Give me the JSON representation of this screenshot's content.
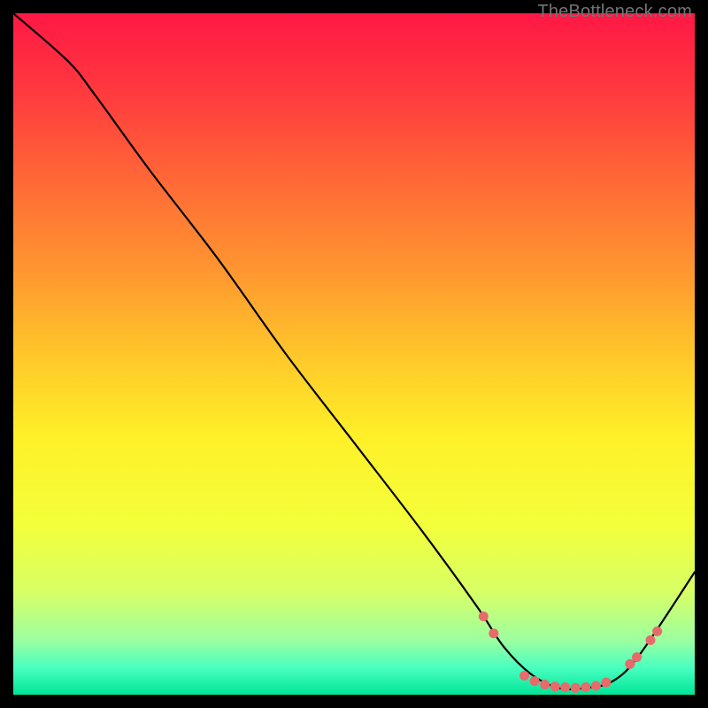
{
  "watermark": "TheBottleneck.com",
  "chart_data": {
    "type": "line",
    "title": "",
    "xlabel": "",
    "ylabel": "",
    "xlim": [
      0,
      100
    ],
    "ylim": [
      0,
      100
    ],
    "grid": false,
    "legend": false,
    "background_gradient_stops": [
      {
        "offset": 0.0,
        "color": "#ff1845"
      },
      {
        "offset": 0.12,
        "color": "#ff3b3e"
      },
      {
        "offset": 0.25,
        "color": "#ff6a36"
      },
      {
        "offset": 0.38,
        "color": "#ff9730"
      },
      {
        "offset": 0.5,
        "color": "#ffc62a"
      },
      {
        "offset": 0.62,
        "color": "#fff028"
      },
      {
        "offset": 0.75,
        "color": "#f3ff3a"
      },
      {
        "offset": 0.85,
        "color": "#d7ff66"
      },
      {
        "offset": 0.92,
        "color": "#9cffa0"
      },
      {
        "offset": 0.96,
        "color": "#4affc0"
      },
      {
        "offset": 1.0,
        "color": "#00e598"
      }
    ],
    "series": [
      {
        "name": "curve",
        "color": "#000000",
        "x": [
          0,
          8,
          12,
          20,
          30,
          40,
          50,
          60,
          68,
          72,
          76,
          80,
          84,
          88,
          92,
          100
        ],
        "y": [
          100,
          93,
          88,
          77,
          64,
          50,
          37,
          24,
          13,
          7,
          3,
          1,
          1,
          2,
          6,
          18
        ]
      }
    ],
    "markers": {
      "name": "dots",
      "color": "#e86a6a",
      "radius": 5.5,
      "points": [
        {
          "x": 69.0,
          "y": 11.5
        },
        {
          "x": 70.5,
          "y": 9.0
        },
        {
          "x": 75.0,
          "y": 2.8
        },
        {
          "x": 76.5,
          "y": 2.0
        },
        {
          "x": 78.0,
          "y": 1.5
        },
        {
          "x": 79.5,
          "y": 1.2
        },
        {
          "x": 81.0,
          "y": 1.1
        },
        {
          "x": 82.5,
          "y": 1.0
        },
        {
          "x": 84.0,
          "y": 1.1
        },
        {
          "x": 85.5,
          "y": 1.3
        },
        {
          "x": 87.0,
          "y": 1.8
        },
        {
          "x": 90.5,
          "y": 4.5
        },
        {
          "x": 91.5,
          "y": 5.5
        },
        {
          "x": 93.5,
          "y": 8.0
        },
        {
          "x": 94.5,
          "y": 9.3
        }
      ]
    }
  }
}
